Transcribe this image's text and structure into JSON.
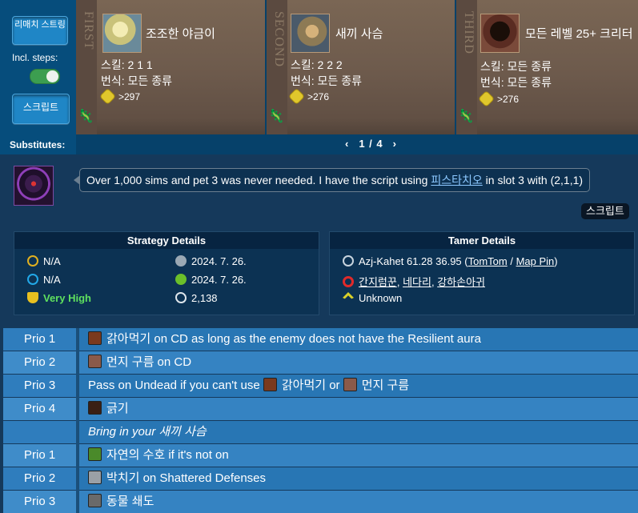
{
  "controls": {
    "rematch_label": "리매치 스트링",
    "incl_steps_label": "Incl. steps:",
    "incl_steps_on": true,
    "script_label": "스크립트",
    "substitutes_label": "Substitutes:"
  },
  "cards": [
    {
      "ordinal": "FIRST",
      "name": "조조한 야금이",
      "skill": "스킬: 2 1 1",
      "breed": "번식: 모든 종류",
      "count": ">297",
      "portrait_color": "#c9c27a"
    },
    {
      "ordinal": "SECOND",
      "name": "새끼 사슴",
      "skill": "스킬: 2 2 2",
      "breed": "번식: 모든 종류",
      "count": ">276",
      "portrait_color": "#b49a68"
    },
    {
      "ordinal": "THIRD",
      "name": "모든 레벨 25+ 크리터",
      "skill": "스킬: 모든 종류",
      "breed": "번식: 모든 종류",
      "count": ">276",
      "portrait_color": "#5a2c22"
    }
  ],
  "pager": {
    "prev": "‹",
    "label": "1 / 4",
    "next": "›"
  },
  "comment": {
    "before": "Over 1,000 sims and pet 3 was never needed. I have the script using ",
    "link": "피스타치오",
    "after": " in slot 3 with (2,1,1)",
    "script_tag": "스크립트"
  },
  "strategy_details": {
    "title": "Strategy Details",
    "left": [
      "N/A",
      "N/A",
      "Very High"
    ],
    "right": [
      "2024. 7. 26.",
      "2024. 7. 26.",
      "2,138"
    ]
  },
  "tamer_details": {
    "title": "Tamer Details",
    "location_prefix": "Azj-Kahet 61.28 36.95 (",
    "tomtom": "TomTom",
    "sep": " / ",
    "map_pin": "Map Pin",
    "location_suffix": ")",
    "npcs": [
      "간지럼꾼",
      "네다리",
      "강하손아귀"
    ],
    "difficulty": "Unknown"
  },
  "priorities": [
    {
      "label": "Prio 1",
      "spell": "갉아먹기",
      "text": " on CD as long as the enemy does not have the Resilient aura",
      "icon": "#7a3a1e"
    },
    {
      "label": "Prio 2",
      "spell": "먼지 구름",
      "text": " on CD",
      "icon": "#8a5a4a"
    },
    {
      "label": "Prio 3",
      "pre": "Pass on Undead if you can't use ",
      "spell": "갉아먹기",
      "mid": " or ",
      "spell2": "먼지 구름",
      "icon": "#7a3a1e",
      "icon2": "#8a5a4a"
    },
    {
      "label": "Prio 4",
      "spell": "긁기",
      "text": "",
      "icon": "#3a1f14"
    },
    {
      "bringin_prefix": "Bring in your ",
      "bringin_pet": "새끼 사슴"
    },
    {
      "label": "Prio 1",
      "spell": "자연의 수호",
      "text": " if it's not on",
      "icon": "#4a8a2a"
    },
    {
      "label": "Prio 2",
      "spell": "박치기",
      "text": " on Shattered Defenses",
      "icon": "#9aa0a6"
    },
    {
      "label": "Prio 3",
      "spell": "동물 쇄도",
      "text": "",
      "icon": "#6a6a6a"
    }
  ]
}
